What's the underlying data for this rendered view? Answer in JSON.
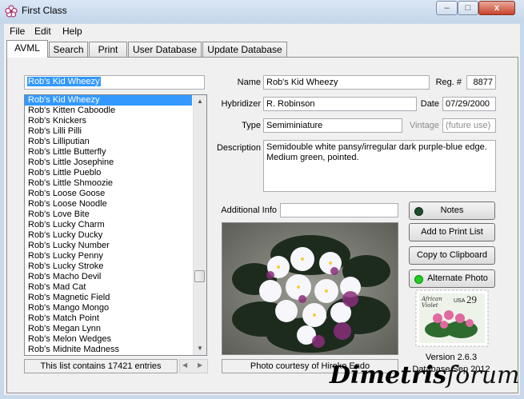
{
  "window": {
    "title": "First Class",
    "buttons": {
      "minimize": "–",
      "maximize": "□",
      "close": "x"
    }
  },
  "menu": [
    "File",
    "Edit",
    "Help"
  ],
  "tabs": [
    {
      "label": "AVML",
      "active": true
    },
    {
      "label": "Search",
      "active": false
    },
    {
      "label": "Print",
      "active": false
    },
    {
      "label": "User Database",
      "active": false
    },
    {
      "label": "Update Database",
      "active": false
    }
  ],
  "search": {
    "value": "Rob's Kid Wheezy"
  },
  "list": {
    "items": [
      "Rob's Kid Wheezy",
      "Rob's Kitten Caboodle",
      "Rob's Knickers",
      "Rob's Lilli Pilli",
      "Rob's Lilliputian",
      "Rob's Little Butterfly",
      "Rob's Little Josephine",
      "Rob's Little Pueblo",
      "Rob's Little Shmoozie",
      "Rob's Loose Goose",
      "Rob's Loose Noodle",
      "Rob's Love Bite",
      "Rob's Lucky Charm",
      "Rob's Lucky Ducky",
      "Rob's Lucky Number",
      "Rob's Lucky Penny",
      "Rob's Lucky Stroke",
      "Rob's Macho Devil",
      "Rob's Mad Cat",
      "Rob's Magnetic Field",
      "Rob's Mango Mongo",
      "Rob's Match Point",
      "Rob's Megan Lynn",
      "Rob's Melon Wedges",
      "Rob's Midnite Madness"
    ],
    "selected_index": 0,
    "status": "This list contains 17421 entries"
  },
  "record": {
    "name_label": "Name",
    "name": "Rob's Kid Wheezy",
    "reg_label": "Reg. #",
    "reg": "8877",
    "hybridizer_label": "Hybridizer",
    "hybridizer": "R. Robinson",
    "date_label": "Date",
    "date": "07/29/2000",
    "type_label": "Type",
    "type": "Semiminiature",
    "vintage_label": "Vintage",
    "vintage": "(future use)",
    "description_label": "Description",
    "description": "Semidouble white pansy/irregular dark purple-blue edge. Medium green, pointed.",
    "additional_label": "Additional Info",
    "additional": ""
  },
  "buttons": {
    "notes": "Notes",
    "add_print": "Add to Print List",
    "copy_clipboard": "Copy to Clipboard",
    "alternate_photo": "Alternate Photo"
  },
  "photo": {
    "caption": "Photo courtesy of Hiroko Endo"
  },
  "stamp": {
    "text1": "African",
    "text2": "Violet",
    "country": "USA",
    "value": "29"
  },
  "version": "Version 2.6.3",
  "database": "Database Sep 2012",
  "watermark": {
    "part1": "Dimetris",
    "part2": "forum"
  },
  "colors": {
    "selection": "#3399ff",
    "led_notes": "#1e4d2b",
    "led_alternate": "#22cc22"
  }
}
